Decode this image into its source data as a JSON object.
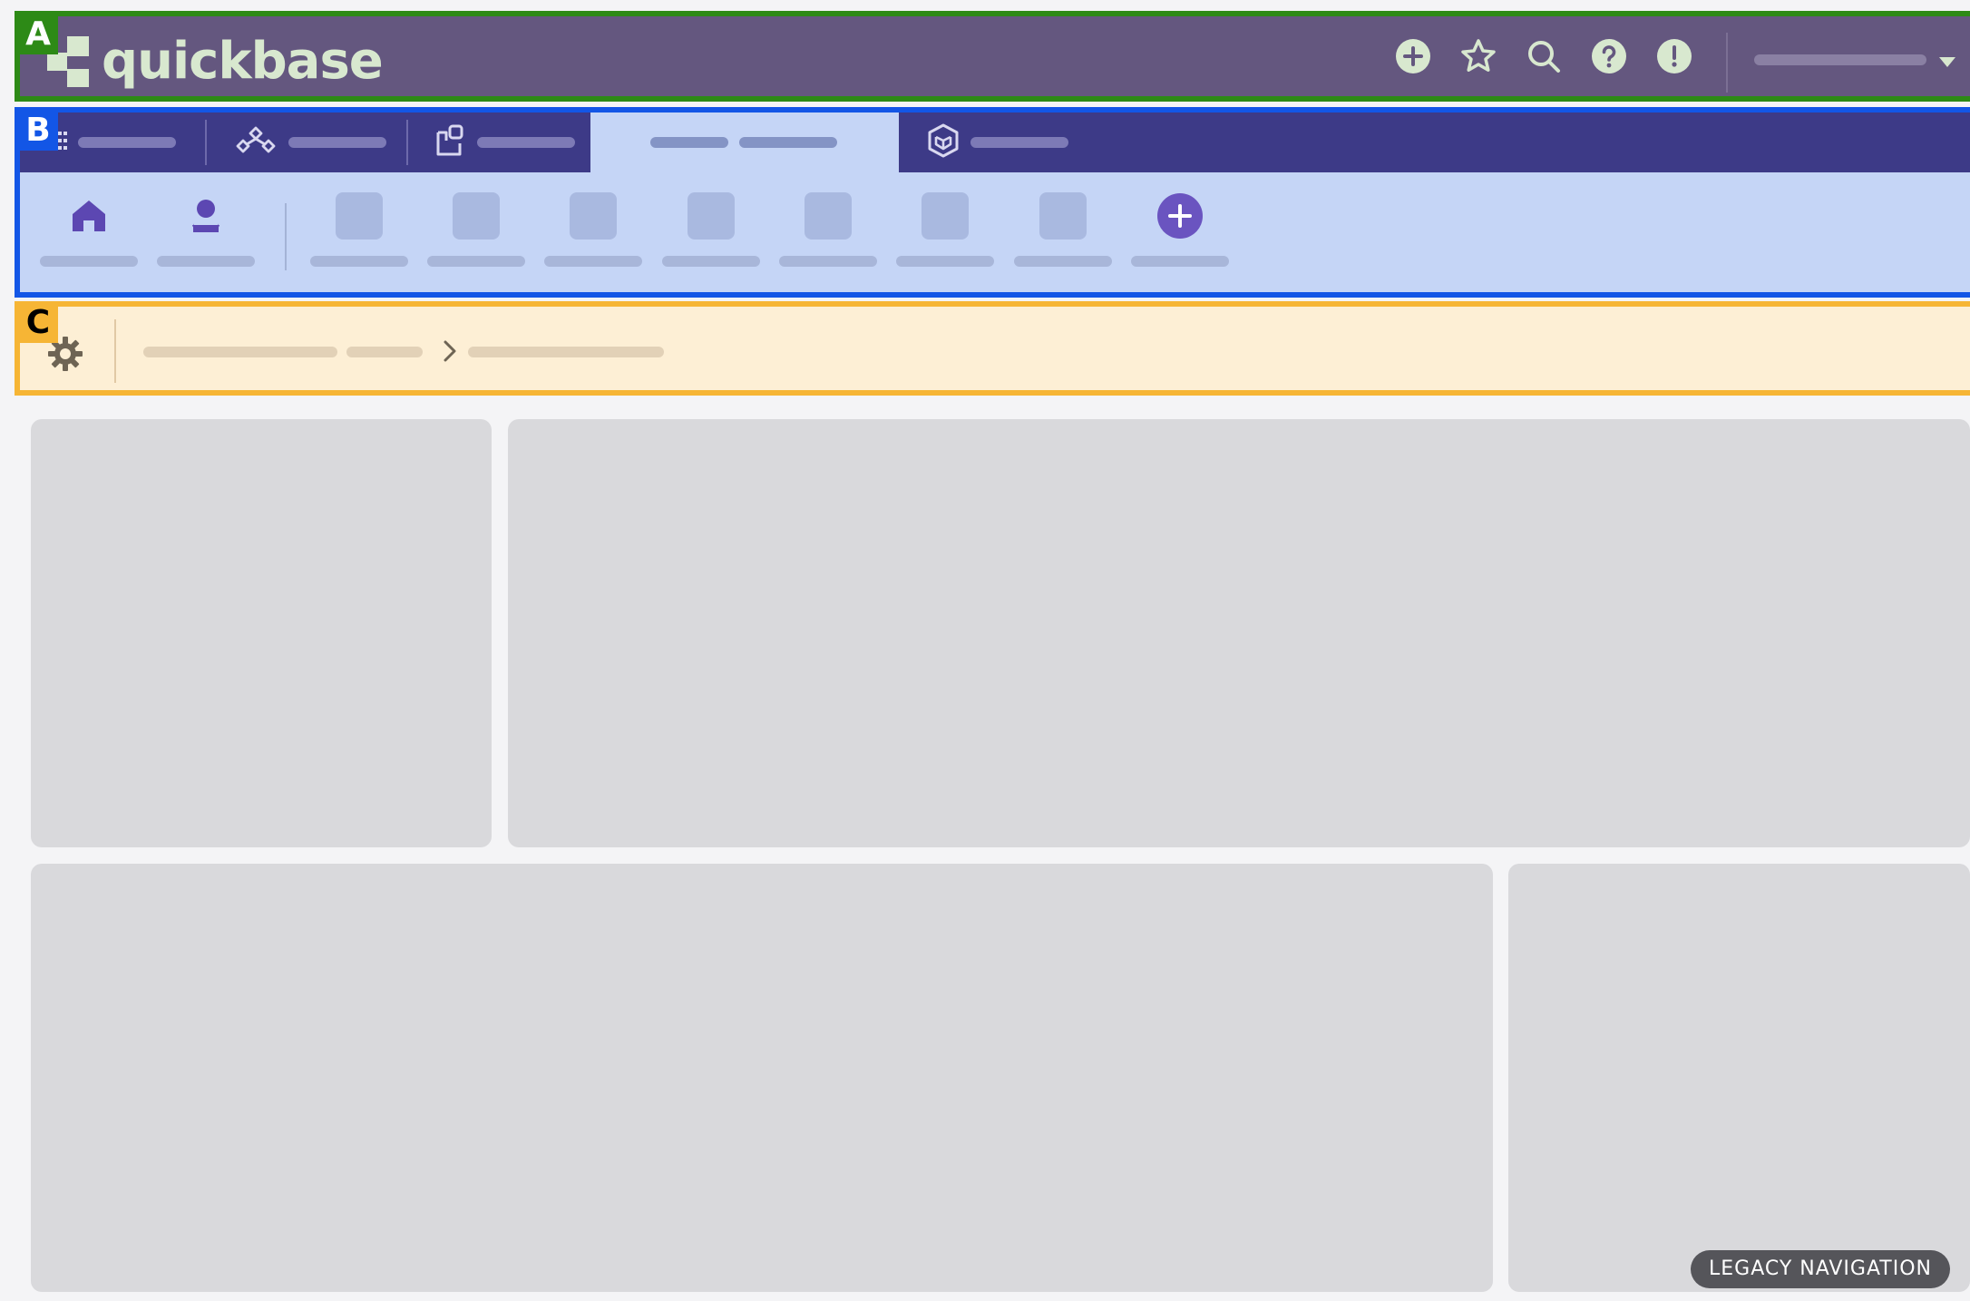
{
  "brand": {
    "name": "quickbase"
  },
  "region_labels": {
    "a": "A",
    "b": "B",
    "c": "C"
  },
  "topbar": {
    "icons": [
      "plus-circle-icon",
      "star-icon",
      "search-icon",
      "help-icon",
      "alert-icon"
    ],
    "user_menu_icon": "chevron-down-icon"
  },
  "app_nav": {
    "tabs": [
      {
        "icon": "grid-icon",
        "active": false
      },
      {
        "icon": "pipelines-icon",
        "active": false
      },
      {
        "icon": "exchange-icon",
        "active": false
      },
      {
        "icon": "none",
        "active": true
      },
      {
        "icon": "cube-icon",
        "active": false
      }
    ],
    "toolbar": [
      {
        "icon": "home-icon"
      },
      {
        "icon": "user-icon"
      },
      {
        "icon": "table-icon"
      },
      {
        "icon": "table-icon"
      },
      {
        "icon": "table-icon"
      },
      {
        "icon": "table-icon"
      },
      {
        "icon": "table-icon"
      },
      {
        "icon": "table-icon"
      },
      {
        "icon": "table-icon"
      },
      {
        "icon": "add-table-icon"
      }
    ]
  },
  "breadcrumb": {
    "icon": "gear-icon",
    "separator_icon": "chevron-right-icon"
  },
  "colors": {
    "region_a": "#2d8a16",
    "region_b": "#1356e6",
    "region_c": "#f6b535",
    "topbar_bg": "#64577f",
    "accent": "#6a54c0"
  },
  "footer": {
    "legacy_button": "LEGACY NAVIGATION"
  }
}
